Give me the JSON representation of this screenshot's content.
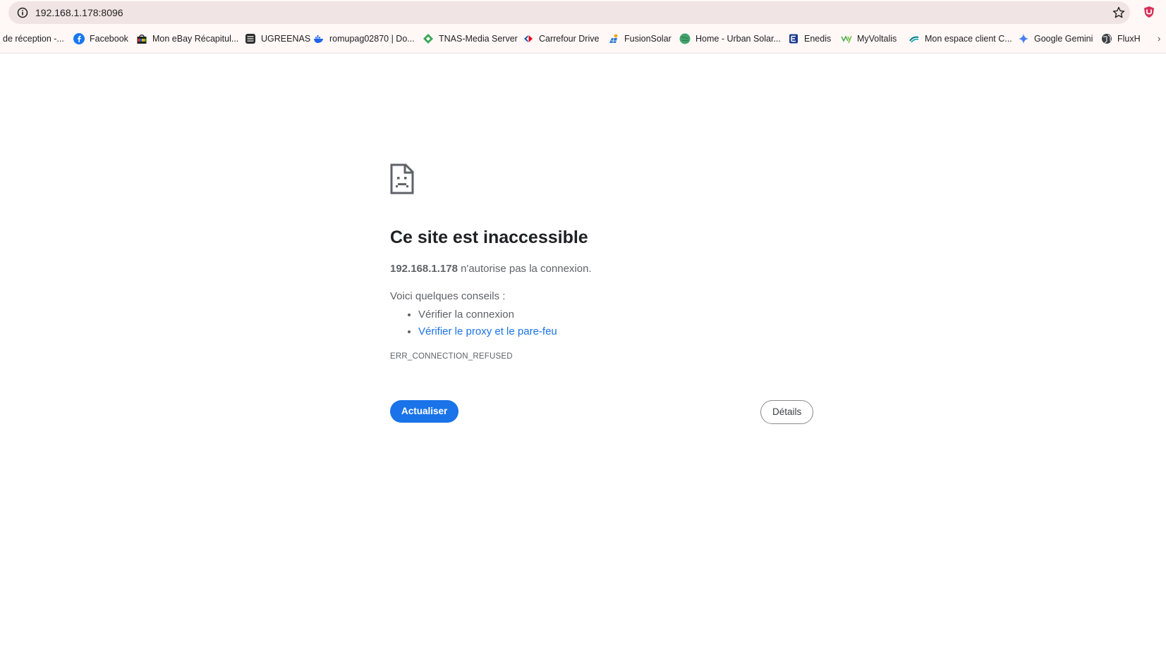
{
  "browser": {
    "url": "192.168.1.178:8096",
    "icons": {
      "site_info": "info-icon",
      "bookmark_star": "star-icon",
      "extension": "shield-extension-icon"
    },
    "bookmarks": [
      {
        "label": "de réception -...",
        "icon": "none"
      },
      {
        "label": "Facebook",
        "icon": "facebook-icon"
      },
      {
        "label": "Mon eBay Récapitul...",
        "icon": "ebay-bag-icon"
      },
      {
        "label": "UGREENAS",
        "icon": "nas-icon"
      },
      {
        "label": "romupag02870 | Do...",
        "icon": "docker-whale-icon"
      },
      {
        "label": "TNAS-Media Server",
        "icon": "diamond-icon"
      },
      {
        "label": "Carrefour Drive",
        "icon": "carrefour-icon"
      },
      {
        "label": "FusionSolar",
        "icon": "solar-icon"
      },
      {
        "label": "Home - Urban Solar...",
        "icon": "globe-green-icon"
      },
      {
        "label": "Enedis",
        "icon": "enedis-icon"
      },
      {
        "label": "MyVoltalis",
        "icon": "voltalis-icon"
      },
      {
        "label": "Mon espace client C...",
        "icon": "credit-agricole-icon"
      },
      {
        "label": "Google Gemini",
        "icon": "gemini-sparkle-icon"
      },
      {
        "label": "FluxH",
        "icon": "globe-icon"
      }
    ],
    "more_bookmarks": "›"
  },
  "error_page": {
    "icon": "sad-document-icon",
    "title": "Ce site est inaccessible",
    "host": "192.168.1.178",
    "description_rest": "n'autorise pas la connexion.",
    "tips_intro": "Voici quelques conseils :",
    "tips": [
      {
        "label": "Vérifier la connexion",
        "is_link": false
      },
      {
        "label": "Vérifier le proxy et le pare-feu",
        "is_link": true
      }
    ],
    "error_code": "ERR_CONNECTION_REFUSED",
    "reload_label": "Actualiser",
    "details_label": "Détails"
  },
  "colors": {
    "primary_button": "#1a73e8",
    "link": "#1a73e8",
    "omnibox_bg": "#f1e4e4",
    "toolbar_bg": "#fff8f7"
  }
}
